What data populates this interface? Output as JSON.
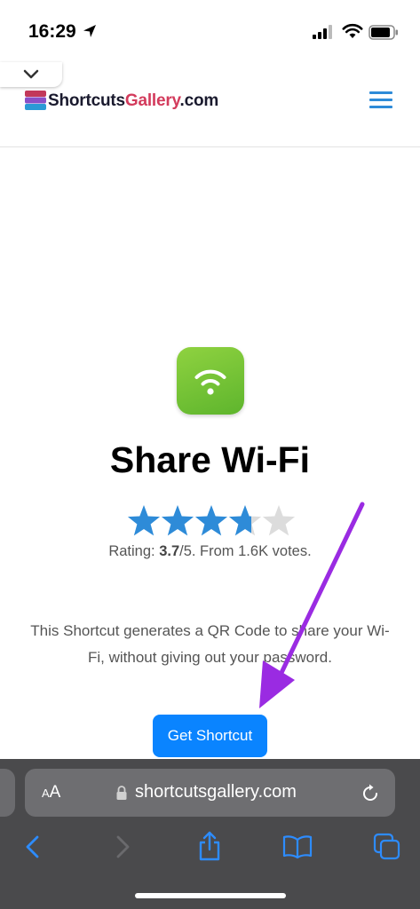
{
  "status_bar": {
    "time": "16:29"
  },
  "site": {
    "logo_part1": "Shortcuts",
    "logo_part2": "Gallery",
    "logo_part3": ".com"
  },
  "shortcut": {
    "title": "Share Wi-Fi",
    "rating_label": "Rating: ",
    "rating_value": "3.7",
    "rating_rest": "/5. From 1.6K votes.",
    "rating_stars": 3.7,
    "rating_max": 5,
    "description": "This Shortcut generates a QR Code to share your Wi-Fi, without giving out your password.",
    "button_label": "Get Shortcut"
  },
  "browser": {
    "text_size_big": "A",
    "text_size_small": "A",
    "url": "shortcutsgallery.com"
  },
  "colors": {
    "accent_blue": "#0a84ff",
    "star_blue": "#2e8bd8",
    "star_empty": "#dcdcdc",
    "arrow_purple": "#9a2be2",
    "icon_green": "#6cc235"
  }
}
